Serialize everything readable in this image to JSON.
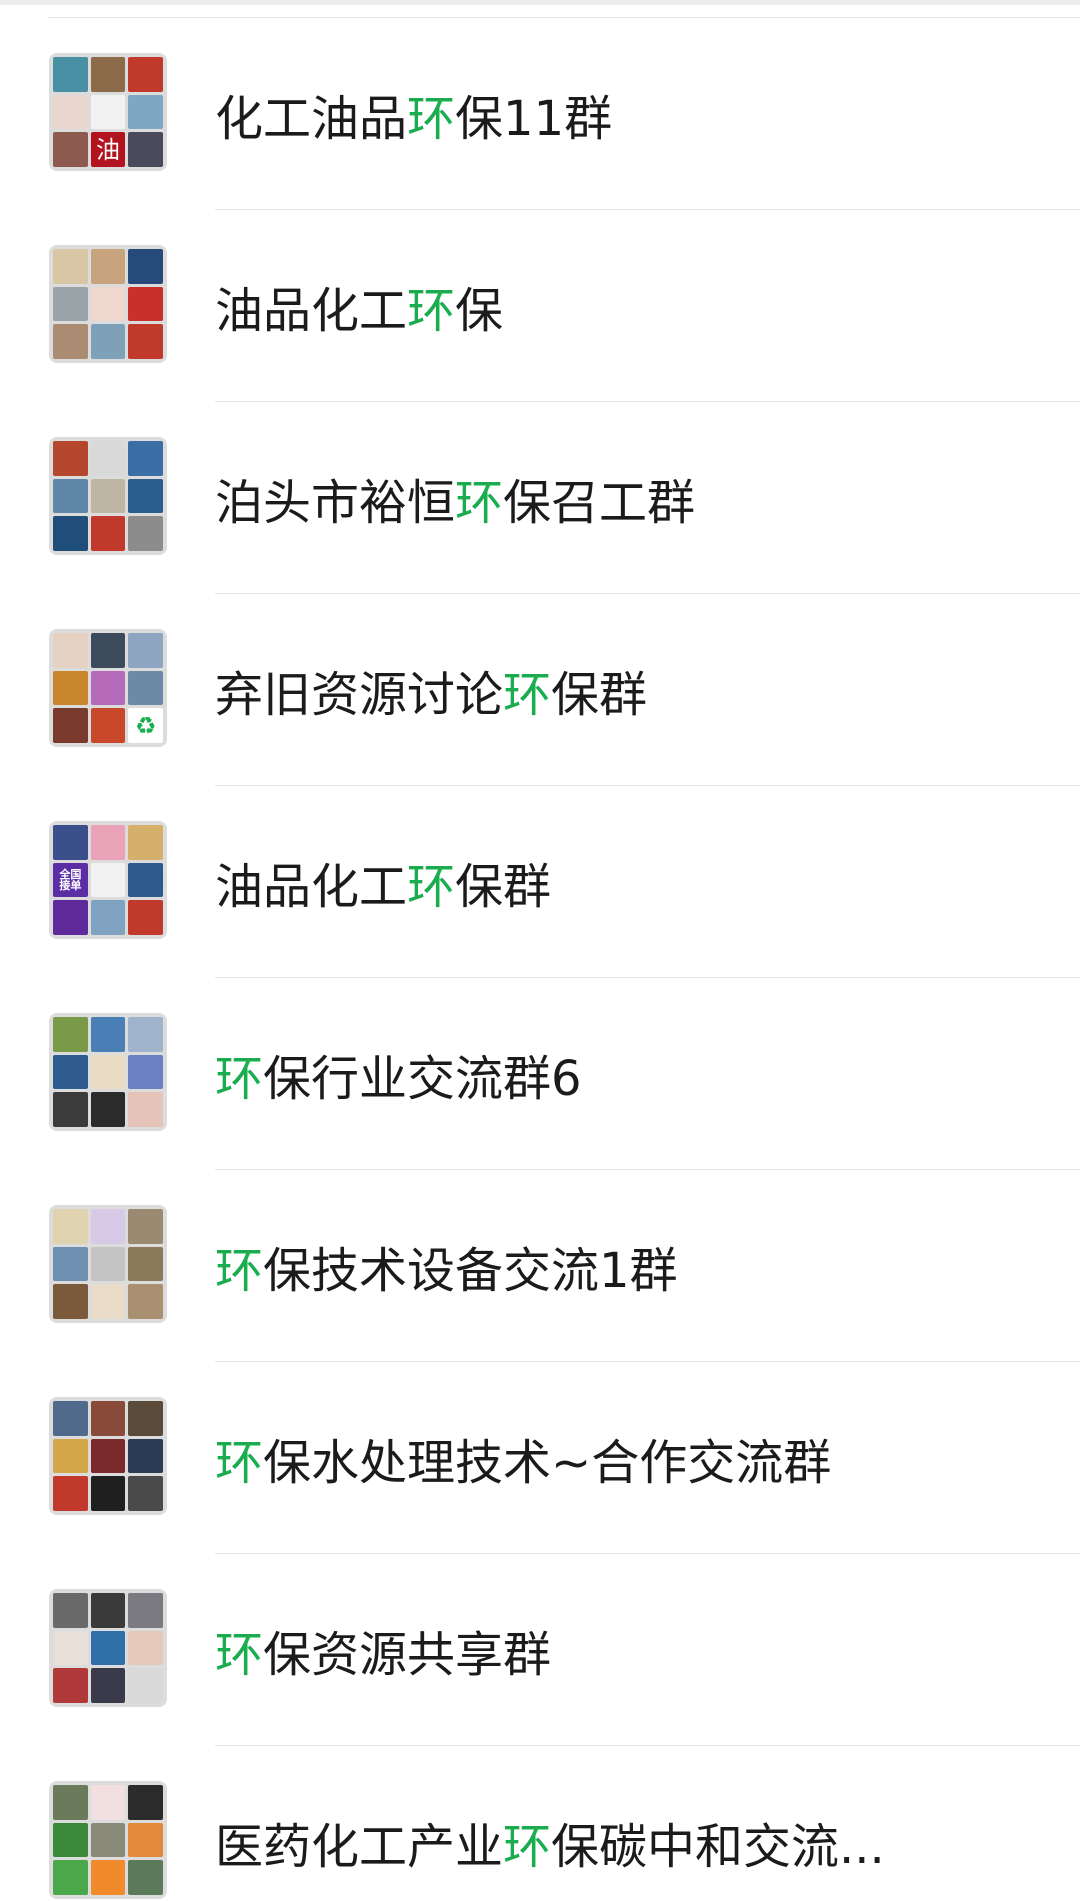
{
  "keyword": "环",
  "groups": [
    {
      "pre": "化工油品",
      "hl": "环",
      "post": "保11群",
      "tiles": [
        {
          "bg": "#4a90a4"
        },
        {
          "bg": "#8b6b4a"
        },
        {
          "bg": "#c0392b"
        },
        {
          "bg": "#e8d6cf"
        },
        {
          "bg": "#f2f2f2"
        },
        {
          "bg": "#7fa6c2"
        },
        {
          "bg": "#8c5a4f"
        },
        {
          "bg": "#b3121f",
          "text": "油"
        },
        {
          "bg": "#4a4a5a"
        }
      ]
    },
    {
      "pre": "油品化工",
      "hl": "环",
      "post": "保",
      "tiles": [
        {
          "bg": "#d9c6a5"
        },
        {
          "bg": "#c7a37e"
        },
        {
          "bg": "#264b7a"
        },
        {
          "bg": "#9aa3a8"
        },
        {
          "bg": "#f0d7cf"
        },
        {
          "bg": "#c9302c"
        },
        {
          "bg": "#a98c72"
        },
        {
          "bg": "#7ea0b8"
        },
        {
          "bg": "#c0392b"
        }
      ]
    },
    {
      "pre": "泊头市裕恒",
      "hl": "环",
      "post": "保召工群",
      "tiles": [
        {
          "bg": "#b5472e"
        },
        {
          "bg": "#d9d9d9"
        },
        {
          "bg": "#3a6ea5"
        },
        {
          "bg": "#5f86a6"
        },
        {
          "bg": "#bfb5a5"
        },
        {
          "bg": "#2c5d8f"
        },
        {
          "bg": "#1f4e7a"
        },
        {
          "bg": "#c0392b"
        },
        {
          "bg": "#8c8c8c"
        }
      ]
    },
    {
      "pre": "弃旧资源讨论",
      "hl": "环",
      "post": "保群",
      "tiles": [
        {
          "bg": "#e6d2c3"
        },
        {
          "bg": "#3d4a5c"
        },
        {
          "bg": "#8da5c0"
        },
        {
          "bg": "#c9862c"
        },
        {
          "bg": "#b46ab8"
        },
        {
          "bg": "#6b8aa8"
        },
        {
          "bg": "#7a3b2e"
        },
        {
          "bg": "#c9482c"
        },
        {
          "bg": "#ffffff",
          "text": "♻",
          "color": "#1aad4f"
        }
      ]
    },
    {
      "pre": "油品化工",
      "hl": "环",
      "post": "保群",
      "tiles": [
        {
          "bg": "#3b4f8c"
        },
        {
          "bg": "#e9a2b8"
        },
        {
          "bg": "#d4b06a"
        },
        {
          "bg": "#5b2ea6",
          "text": "全国\n接单"
        },
        {
          "bg": "#f2f2f2"
        },
        {
          "bg": "#2d5a8c"
        },
        {
          "bg": "#5e2a9c"
        },
        {
          "bg": "#7fa2c0"
        },
        {
          "bg": "#c0392b"
        }
      ]
    },
    {
      "pre": "",
      "hl": "环",
      "post": "保行业交流群6",
      "tiles": [
        {
          "bg": "#7a9a4a"
        },
        {
          "bg": "#4a7fb5"
        },
        {
          "bg": "#9fb3cc"
        },
        {
          "bg": "#2e5c8f"
        },
        {
          "bg": "#e8dcc4"
        },
        {
          "bg": "#6a80c2"
        },
        {
          "bg": "#3b3b3b"
        },
        {
          "bg": "#2b2b2b"
        },
        {
          "bg": "#e6c3b8"
        }
      ]
    },
    {
      "pre": "",
      "hl": "环",
      "post": "保技术设备交流1群",
      "tiles": [
        {
          "bg": "#e0d3b0"
        },
        {
          "bg": "#d8c9e6"
        },
        {
          "bg": "#9a8a72"
        },
        {
          "bg": "#6f8fb0"
        },
        {
          "bg": "#c4c4c4"
        },
        {
          "bg": "#8a7a5a"
        },
        {
          "bg": "#7a5a3a"
        },
        {
          "bg": "#e9dcc9"
        },
        {
          "bg": "#a99070"
        }
      ]
    },
    {
      "pre": "",
      "hl": "环",
      "post": "保水处理技术~合作交流群",
      "tiles": [
        {
          "bg": "#4f6a8a"
        },
        {
          "bg": "#8a4a3a"
        },
        {
          "bg": "#5a4a3a"
        },
        {
          "bg": "#d4a64a"
        },
        {
          "bg": "#7a2a2a"
        },
        {
          "bg": "#2b3a55"
        },
        {
          "bg": "#c0392b"
        },
        {
          "bg": "#1f1f1f"
        },
        {
          "bg": "#4a4a4a"
        }
      ]
    },
    {
      "pre": "",
      "hl": "环",
      "post": "保资源共享群",
      "tiles": [
        {
          "bg": "#6a6a6a"
        },
        {
          "bg": "#3a3a3a"
        },
        {
          "bg": "#7a7a80"
        },
        {
          "bg": "#e8e0d8"
        },
        {
          "bg": "#2e6fa8"
        },
        {
          "bg": "#e6c8b8"
        },
        {
          "bg": "#b03a3a"
        },
        {
          "bg": "#3a3a4a"
        },
        {
          "bg": "#d9d9d9"
        }
      ]
    },
    {
      "pre": "医药化工产业",
      "hl": "环",
      "post": "保碳中和交流...",
      "tiles": [
        {
          "bg": "#6a7a5a"
        },
        {
          "bg": "#f2e0e0"
        },
        {
          "bg": "#2b2b2b"
        },
        {
          "bg": "#3a8a3a"
        },
        {
          "bg": "#8a8a7a"
        },
        {
          "bg": "#e08a3a"
        },
        {
          "bg": "#4aa84a"
        },
        {
          "bg": "#f08a2a"
        },
        {
          "bg": "#5a7a5a"
        }
      ]
    }
  ]
}
